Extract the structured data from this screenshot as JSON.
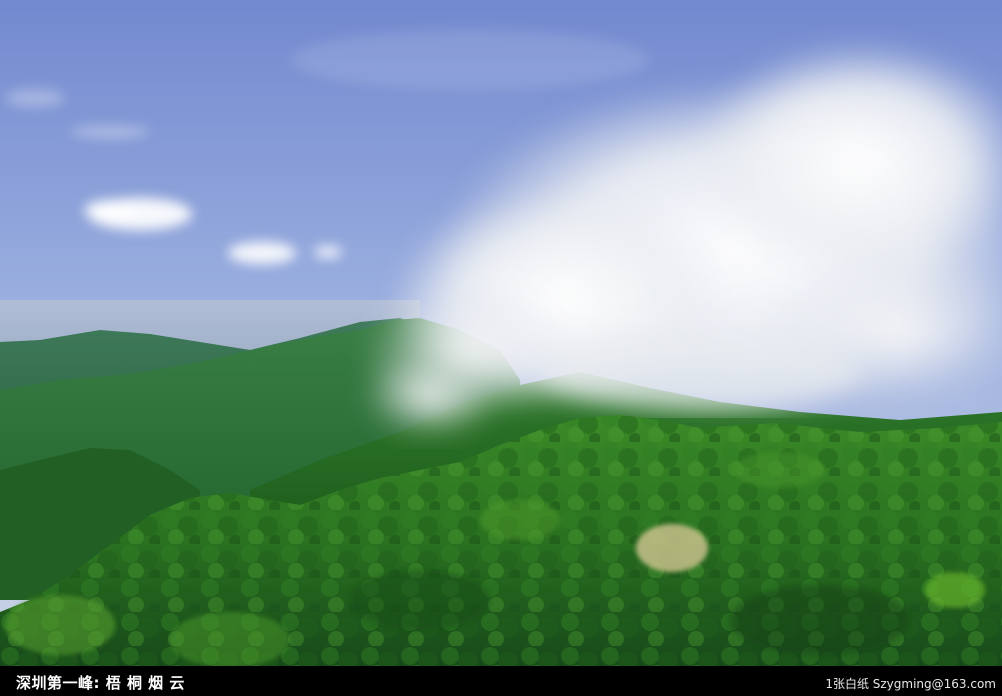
{
  "photo": {
    "subject": "mountain-landscape-photo"
  },
  "caption": {
    "title": "深圳第一峰: 梧 桐 烟 云",
    "credit": "1张白纸 Szygming@163.com"
  },
  "colors": {
    "sky_top": "#7d94d6",
    "sky_horizon": "#c9d2e6",
    "forest_dark": "#1d5a1e",
    "forest_light": "#3f8f2a",
    "cloud": "#ecedef",
    "caption_bg": "#000000",
    "caption_text": "#ffffff"
  }
}
